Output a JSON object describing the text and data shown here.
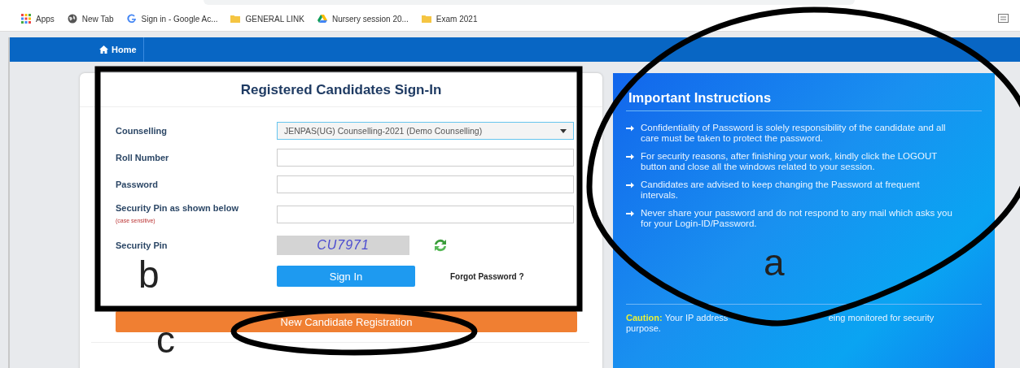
{
  "bookmarks": [
    {
      "kind": "apps",
      "label": "Apps"
    },
    {
      "kind": "globe",
      "label": "New Tab"
    },
    {
      "kind": "google",
      "label": "Sign in - Google Ac..."
    },
    {
      "kind": "folder",
      "label": "GENERAL LINK"
    },
    {
      "kind": "drive",
      "label": "Nursery session 20..."
    },
    {
      "kind": "folder",
      "label": "Exam 2021"
    }
  ],
  "nav": {
    "items": [
      {
        "label": "Home",
        "selected": true
      }
    ]
  },
  "signin": {
    "title": "Registered Candidates Sign-In",
    "fields": [
      {
        "kind": "select",
        "label": "Counselling",
        "value": "JENPAS(UG) Counselling-2021 (Demo Counselling)"
      },
      {
        "kind": "input",
        "label": "Roll Number"
      },
      {
        "kind": "input",
        "label": "Password"
      },
      {
        "kind": "input",
        "label": "Security Pin as shown below",
        "note": "(case sensitive)"
      },
      {
        "kind": "captcha",
        "label": "Security Pin",
        "value": "CU7971"
      }
    ],
    "button": "Sign In",
    "forgot": "Forgot Password ?",
    "register": "New Candidate Registration"
  },
  "instructions": {
    "title": "Important Instructions",
    "items": [
      "Confidentiality of Password is solely responsibility of the candidate and all care must be taken to protect the password.",
      "For security reasons, after finishing your work, kindly click the LOGOUT button and close all the windows related to your session.",
      "Candidates are advised to keep changing the Password at frequent intervals.",
      "Never share your password and do not respond to any mail which asks you for your Login-ID/Password."
    ],
    "caution_label": "Caution:",
    "caution_parts": [
      "Your IP address",
      "eing monitored for security",
      "purpose."
    ]
  },
  "annotations": [
    {
      "kind": "rectangle",
      "label": "b"
    },
    {
      "kind": "ellipse",
      "label": "a"
    },
    {
      "kind": "ellipse",
      "label": "c"
    }
  ]
}
